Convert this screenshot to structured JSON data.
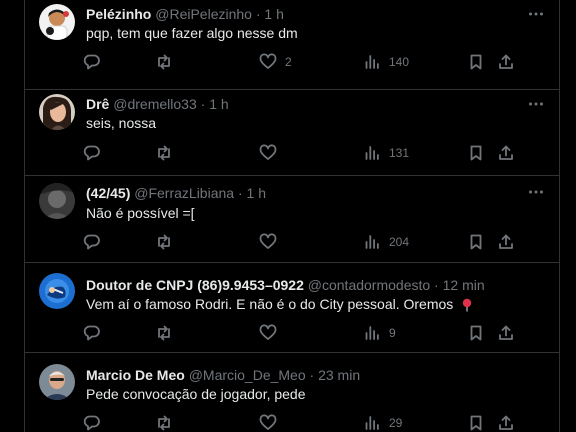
{
  "tweets": [
    {
      "name": "Pelézinho",
      "handle": "@ReiPelezinho",
      "separator": "·",
      "time": "1 h",
      "text": "pqp, tem que fazer algo nesse dm",
      "likes": "2",
      "views": "140"
    },
    {
      "name": "Drê",
      "handle": "@dremello33",
      "separator": "·",
      "time": "1 h",
      "text": "seis, nossa",
      "likes": "",
      "views": "131"
    },
    {
      "name": "(42/45)",
      "handle": "@FerrazLibiana",
      "separator": "·",
      "time": "1 h",
      "text": "Não é possível =[",
      "likes": "",
      "views": "204"
    },
    {
      "name": "Doutor de CNPJ (86)9.9453–0922",
      "handle": "@contadormodesto",
      "separator": "·",
      "time": "12 min",
      "text": "Vem aí o famoso Rodri.  E não é o do City pessoal. Oremos",
      "likes": "",
      "views": "9"
    },
    {
      "name": "Marcio De Meo",
      "handle": "@Marcio_De_Meo",
      "separator": "·",
      "time": "23 min",
      "text": "Pede convocação de jogador, pede",
      "likes": "",
      "views": "29"
    }
  ],
  "icons": {
    "reply": "reply-icon",
    "retweet": "retweet-icon",
    "like": "heart-icon",
    "views": "views-icon",
    "bookmark": "bookmark-icon",
    "share": "share-icon",
    "more": "more-icon",
    "pin": "red-pin-icon"
  },
  "colors": {
    "background": "#000000",
    "text": "#e7e9ea",
    "muted": "#71767b",
    "border": "#2f3336",
    "pin": "#e0304a"
  }
}
